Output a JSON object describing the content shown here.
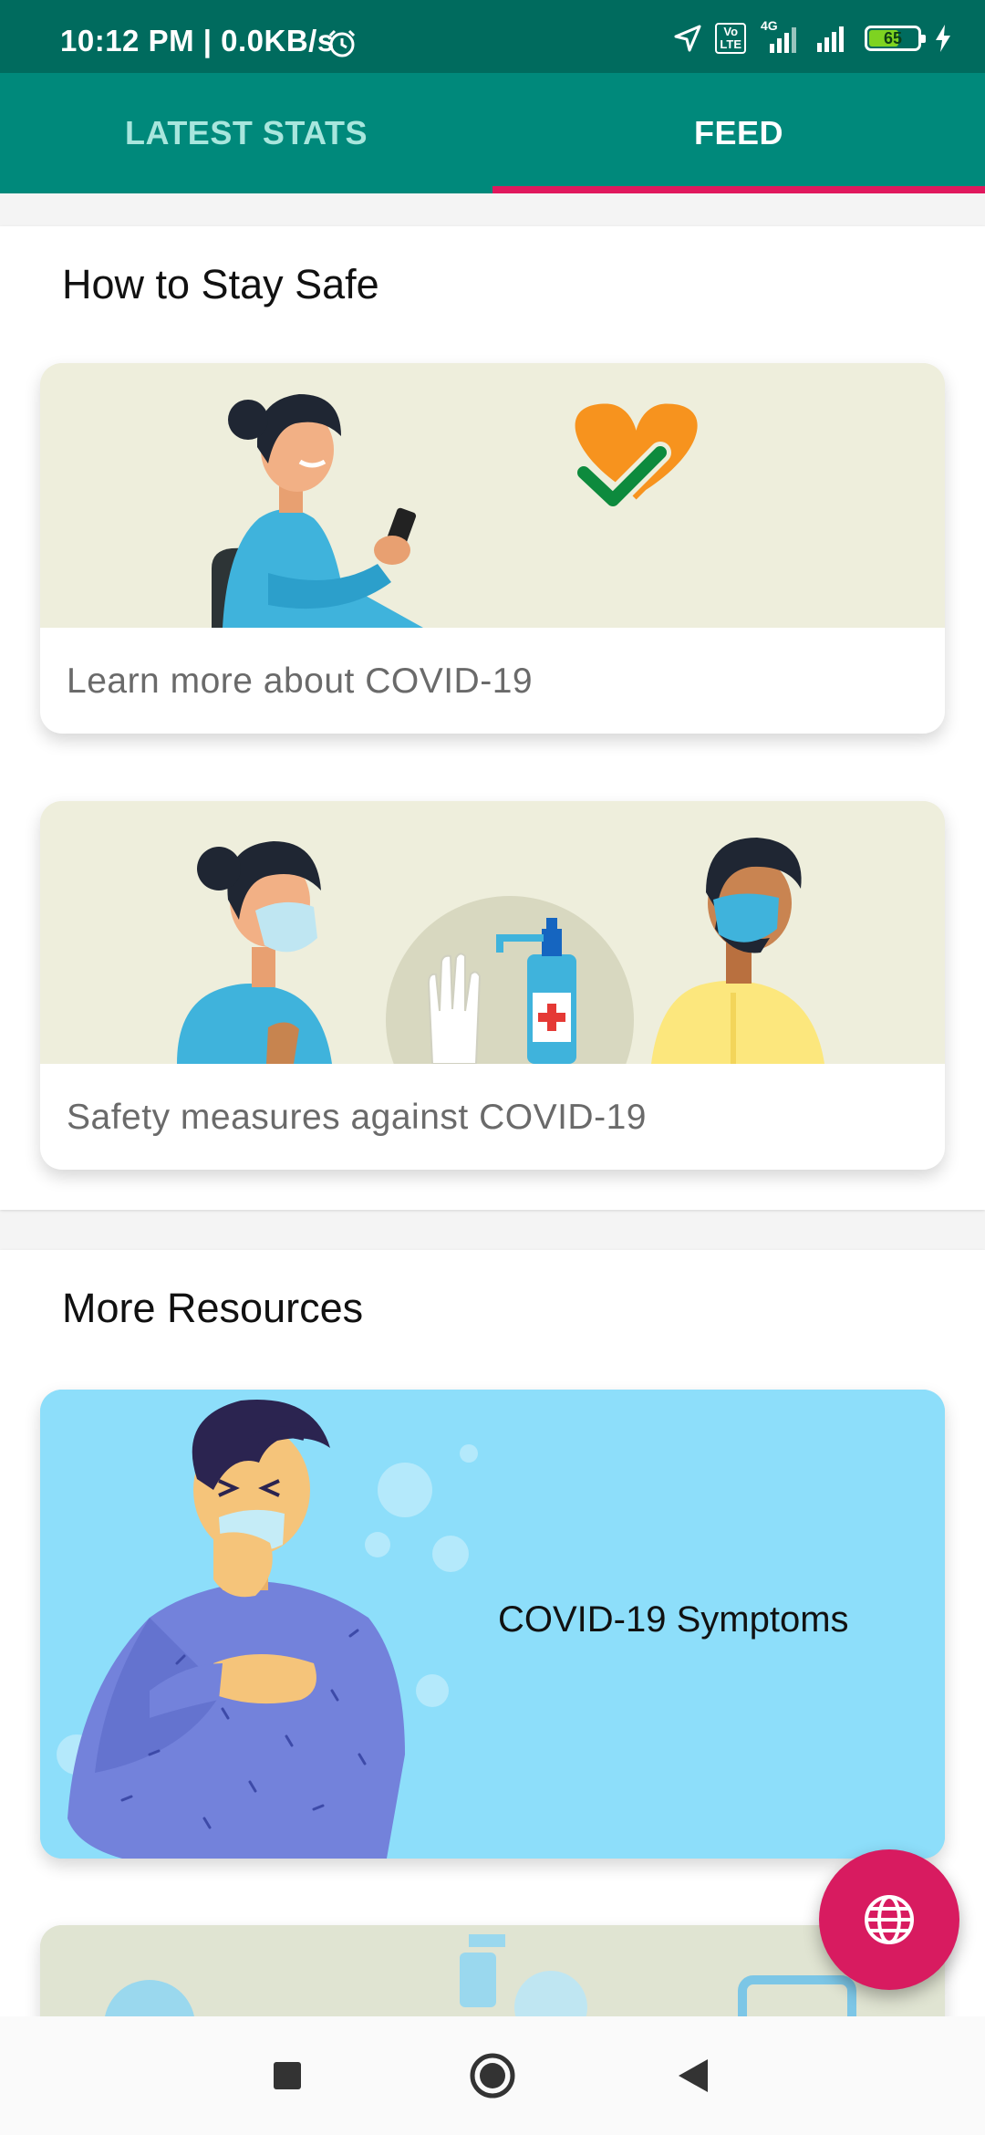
{
  "status_bar": {
    "time_speed": "10:12 PM | 0.0KB/s",
    "volte": "Vo\nLTE",
    "network_type": "4G",
    "battery_level": "65",
    "battery_fraction": 0.65
  },
  "tabs": [
    {
      "label": "LATEST STATS",
      "selected": false
    },
    {
      "label": "FEED",
      "selected": true
    }
  ],
  "colors": {
    "status_bar": "#006b5e",
    "tab_bar": "#00897b",
    "indicator": "#e0185d",
    "fab": "#d81b60",
    "resource_card": "#8ddefa"
  },
  "stay_safe": {
    "title": "How to Stay Safe",
    "cards": [
      {
        "label": "Learn more about COVID-19"
      },
      {
        "label": "Safety measures against COVID-19"
      }
    ]
  },
  "more_resources": {
    "title": "More Resources",
    "cards": [
      {
        "label": "COVID-19 Symptoms"
      }
    ]
  },
  "fab": {
    "icon": "globe-icon"
  },
  "nav": {
    "icons": [
      "recents-square-icon",
      "home-circle-icon",
      "back-triangle-icon"
    ]
  }
}
